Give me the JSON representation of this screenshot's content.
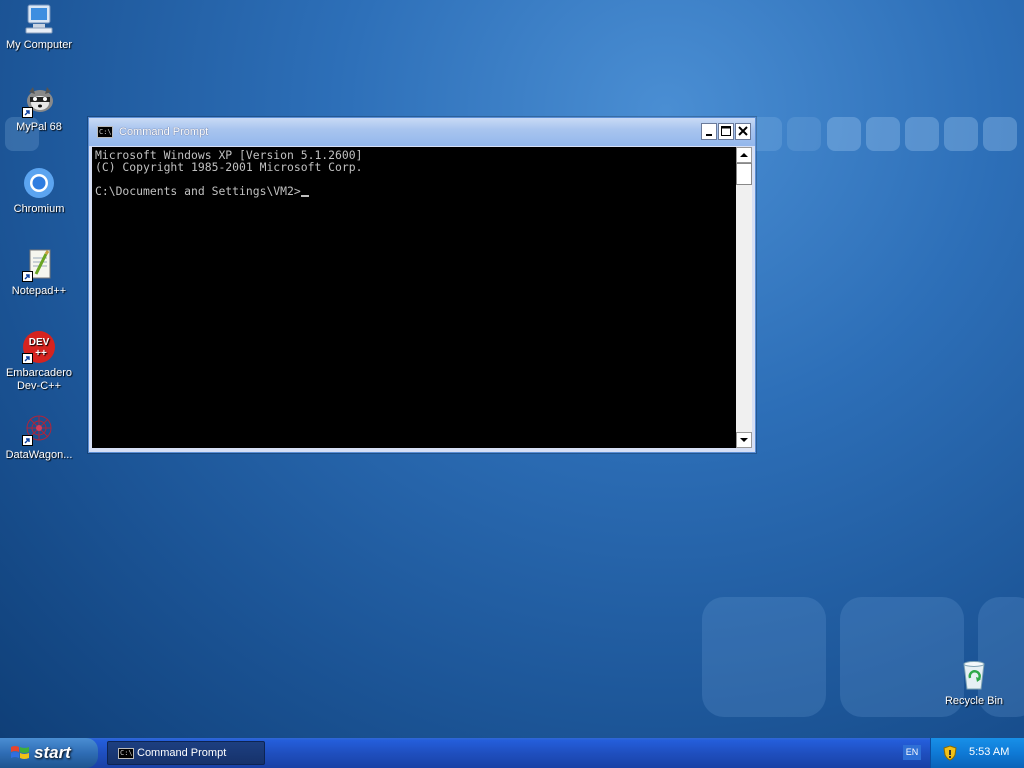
{
  "desktop": {
    "icons": [
      {
        "label": "My Computer",
        "icon": "computer-icon"
      },
      {
        "label": "MyPal 68",
        "icon": "raccoon-icon"
      },
      {
        "label": "Chromium",
        "icon": "chromium-icon"
      },
      {
        "label": "Notepad++",
        "icon": "notepadpp-icon"
      },
      {
        "label": "Embarcadero Dev-C++",
        "icon": "devcpp-icon"
      },
      {
        "label": "DataWagon...",
        "icon": "datawagon-icon"
      },
      {
        "label": "Recycle Bin",
        "icon": "recycle-bin-icon"
      }
    ],
    "devcpp_badge": {
      "line1": "DEV",
      "line2": "++"
    }
  },
  "window": {
    "title": "Command Prompt",
    "icon_text": "C:\\",
    "console_lines": [
      "Microsoft Windows XP [Version 5.1.2600]",
      "(C) Copyright 1985-2001 Microsoft Corp.",
      "",
      "C:\\Documents and Settings\\VM2>"
    ]
  },
  "taskbar": {
    "start_label": "start",
    "tasks": [
      {
        "label": "Command Prompt",
        "icon_text": "C:\\"
      }
    ],
    "language": "EN",
    "clock": "5:53 AM"
  },
  "colors": {
    "desktop_bg": "#2d6fb8",
    "titlebar": "#a9c5ef",
    "console_bg": "#000000",
    "console_fg": "#c0c0c0",
    "taskbar": "#1f4fbf",
    "tray": "#0f7ad6"
  }
}
